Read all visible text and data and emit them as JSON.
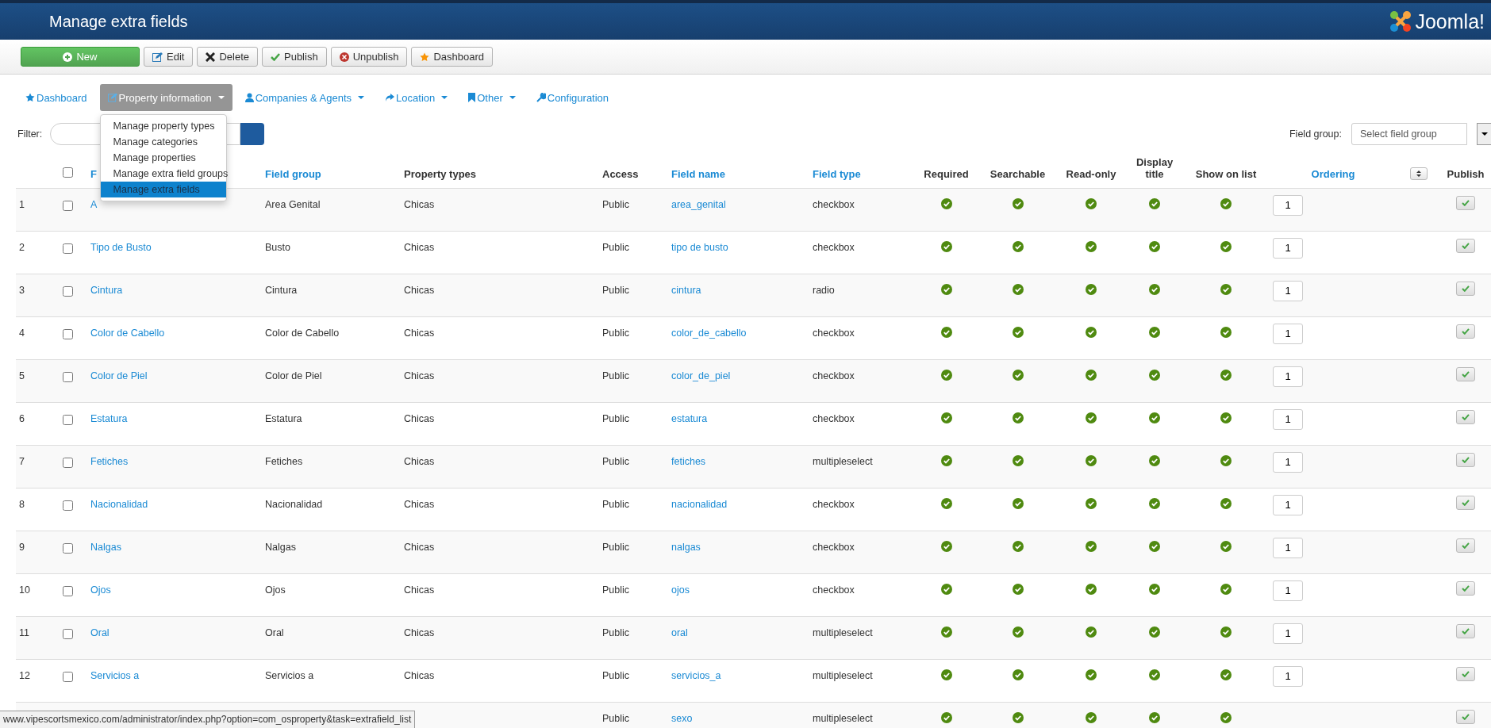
{
  "header": {
    "title": "Manage extra fields",
    "logo_text": "Joomla!"
  },
  "toolbar": [
    {
      "label": "New",
      "kind": "new"
    },
    {
      "label": "Edit",
      "kind": "edit"
    },
    {
      "label": "Delete",
      "kind": "delete"
    },
    {
      "label": "Publish",
      "kind": "publish"
    },
    {
      "label": "Unpublish",
      "kind": "unpublish"
    },
    {
      "label": "Dashboard",
      "kind": "dashboard"
    }
  ],
  "nav": [
    {
      "label": "Dashboard",
      "kind": "star",
      "caret": false,
      "selected": false
    },
    {
      "label": "Property information",
      "kind": "edit",
      "caret": true,
      "selected": true
    },
    {
      "label": "Companies & Agents",
      "kind": "user",
      "caret": true,
      "selected": false
    },
    {
      "label": "Location",
      "kind": "share",
      "caret": true,
      "selected": false
    },
    {
      "label": "Other",
      "kind": "bookmark",
      "caret": true,
      "selected": false
    },
    {
      "label": "Configuration",
      "kind": "wrench",
      "caret": false,
      "selected": false
    }
  ],
  "dropdown": {
    "items": [
      {
        "label": "Manage property types",
        "selected": false
      },
      {
        "label": "Manage categories",
        "selected": false
      },
      {
        "label": "Manage properties",
        "selected": false
      },
      {
        "label": "Manage extra field groups",
        "selected": false
      },
      {
        "label": "Manage extra fields",
        "selected": true
      }
    ]
  },
  "filter": {
    "label": "Filter:"
  },
  "field_group_filter": {
    "label": "Field group:",
    "placeholder": "Select field group"
  },
  "table": {
    "header_checkbox": {
      "checked": false
    },
    "columns": [
      {},
      {},
      {
        "label": "F",
        "link": true
      },
      {
        "label": "Field group",
        "link": true
      },
      {
        "label": "Property types",
        "link": false
      },
      {
        "label": "Access",
        "link": false
      },
      {
        "label": "Field name",
        "link": true
      },
      {
        "label": "Field type",
        "link": true
      },
      {
        "label": "Required",
        "link": false
      },
      {
        "label": "Searchable",
        "link": false
      },
      {
        "label": "Read-only",
        "link": false
      },
      {
        "label": "Display title",
        "link": false
      },
      {
        "label": "Show on list",
        "link": false
      },
      {
        "label": "Ordering",
        "link": true
      },
      {},
      {
        "label": "Publish",
        "link": false
      }
    ],
    "rows": [
      {
        "number": "1",
        "checked": false,
        "title": "A",
        "field_group": "Area Genital",
        "property_types": "Chicas",
        "access": "Public",
        "field_name": "area_genital",
        "field_type": "checkbox",
        "required": true,
        "searchable": true,
        "readonly": true,
        "display_title": true,
        "show_on_list": true,
        "ordering": "1",
        "published": true
      },
      {
        "number": "2",
        "checked": false,
        "title": "Tipo de Busto",
        "field_group": "Busto",
        "property_types": "Chicas",
        "access": "Public",
        "field_name": "tipo de busto",
        "field_type": "checkbox",
        "required": true,
        "searchable": true,
        "readonly": true,
        "display_title": true,
        "show_on_list": true,
        "ordering": "1",
        "published": true
      },
      {
        "number": "3",
        "checked": false,
        "title": "Cintura",
        "field_group": "Cintura",
        "property_types": "Chicas",
        "access": "Public",
        "field_name": "cintura",
        "field_type": "radio",
        "required": true,
        "searchable": true,
        "readonly": true,
        "display_title": true,
        "show_on_list": true,
        "ordering": "1",
        "published": true
      },
      {
        "number": "4",
        "checked": false,
        "title": "Color de Cabello",
        "field_group": "Color de Cabello",
        "property_types": "Chicas",
        "access": "Public",
        "field_name": "color_de_cabello",
        "field_type": "checkbox",
        "required": true,
        "searchable": true,
        "readonly": true,
        "display_title": true,
        "show_on_list": true,
        "ordering": "1",
        "published": true
      },
      {
        "number": "5",
        "checked": false,
        "title": "Color de Piel",
        "field_group": "Color de Piel",
        "property_types": "Chicas",
        "access": "Public",
        "field_name": "color_de_piel",
        "field_type": "checkbox",
        "required": true,
        "searchable": true,
        "readonly": true,
        "display_title": true,
        "show_on_list": true,
        "ordering": "1",
        "published": true
      },
      {
        "number": "6",
        "checked": false,
        "title": "Estatura",
        "field_group": "Estatura",
        "property_types": "Chicas",
        "access": "Public",
        "field_name": "estatura",
        "field_type": "checkbox",
        "required": true,
        "searchable": true,
        "readonly": true,
        "display_title": true,
        "show_on_list": true,
        "ordering": "1",
        "published": true
      },
      {
        "number": "7",
        "checked": false,
        "title": "Fetiches",
        "field_group": "Fetiches",
        "property_types": "Chicas",
        "access": "Public",
        "field_name": "fetiches",
        "field_type": "multipleselect",
        "required": true,
        "searchable": true,
        "readonly": true,
        "display_title": true,
        "show_on_list": true,
        "ordering": "1",
        "published": true
      },
      {
        "number": "8",
        "checked": false,
        "title": "Nacionalidad",
        "field_group": "Nacionalidad",
        "property_types": "Chicas",
        "access": "Public",
        "field_name": "nacionalidad",
        "field_type": "checkbox",
        "required": true,
        "searchable": true,
        "readonly": true,
        "display_title": true,
        "show_on_list": true,
        "ordering": "1",
        "published": true
      },
      {
        "number": "9",
        "checked": false,
        "title": "Nalgas",
        "field_group": "Nalgas",
        "property_types": "Chicas",
        "access": "Public",
        "field_name": "nalgas",
        "field_type": "checkbox",
        "required": true,
        "searchable": true,
        "readonly": true,
        "display_title": true,
        "show_on_list": true,
        "ordering": "1",
        "published": true
      },
      {
        "number": "10",
        "checked": false,
        "title": "Ojos",
        "field_group": "Ojos",
        "property_types": "Chicas",
        "access": "Public",
        "field_name": "ojos",
        "field_type": "checkbox",
        "required": true,
        "searchable": true,
        "readonly": true,
        "display_title": true,
        "show_on_list": true,
        "ordering": "1",
        "published": true
      },
      {
        "number": "11",
        "checked": false,
        "title": "Oral",
        "field_group": "Oral",
        "property_types": "Chicas",
        "access": "Public",
        "field_name": "oral",
        "field_type": "multipleselect",
        "required": true,
        "searchable": true,
        "readonly": true,
        "display_title": true,
        "show_on_list": true,
        "ordering": "1",
        "published": true
      },
      {
        "number": "12",
        "checked": false,
        "title": "Servicios a",
        "field_group": "Servicios a",
        "property_types": "Chicas",
        "access": "Public",
        "field_name": "servicios_a",
        "field_type": "multipleselect",
        "required": true,
        "searchable": true,
        "readonly": true,
        "display_title": true,
        "show_on_list": true,
        "ordering": "1",
        "published": true
      },
      {
        "access": "Public",
        "field_name": "sexo",
        "field_type": "multipleselect",
        "required": true,
        "searchable": true,
        "readonly": true,
        "display_title": true,
        "show_on_list": true,
        "published": true
      }
    ]
  },
  "status_bar": {
    "url": "www.vipescortsmexico.com/administrator/index.php?option=com_osproperty&task=extrafield_list"
  }
}
